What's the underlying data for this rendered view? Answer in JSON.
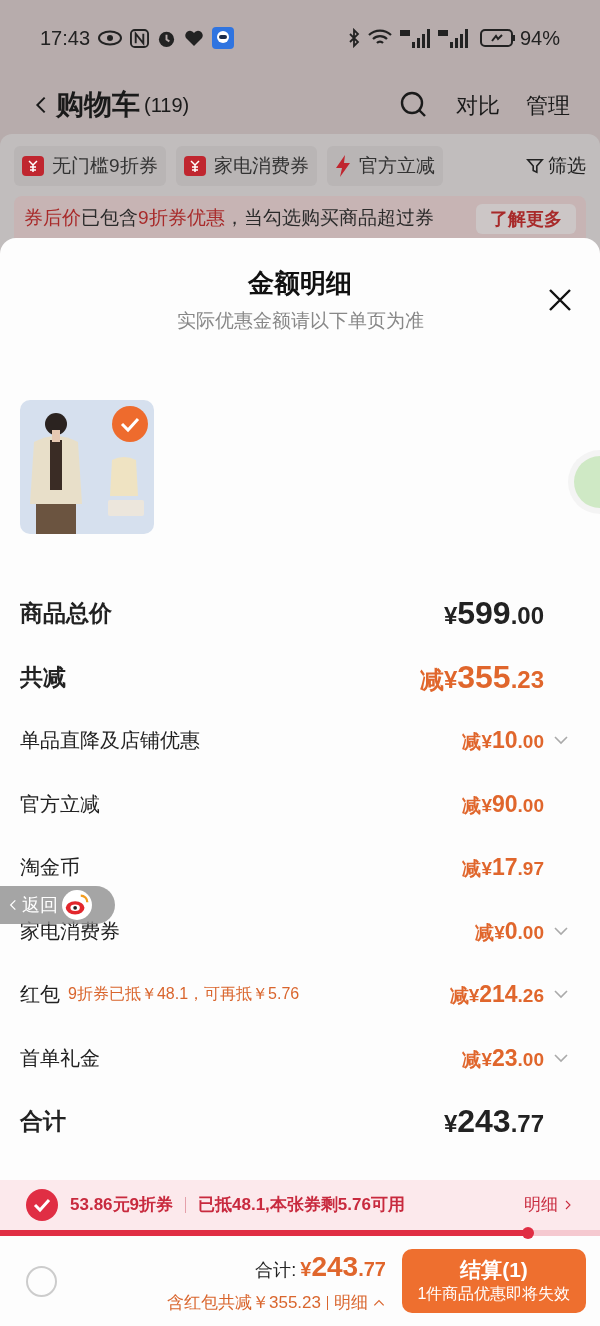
{
  "status_bar": {
    "time": "17:43",
    "battery": "94%"
  },
  "header": {
    "title": "购物车",
    "count": "(119)",
    "actions": [
      "对比",
      "管理"
    ]
  },
  "filters": [
    {
      "label": "无门槛9折券",
      "kind": "coupon"
    },
    {
      "label": "家电消费券",
      "kind": "coupon"
    },
    {
      "label": "官方立减",
      "kind": "bolt"
    },
    {
      "label": "筛选",
      "kind": "filter"
    }
  ],
  "notice": {
    "parts": [
      {
        "text": "券后价",
        "highlight": true
      },
      {
        "text": "已包含",
        "highlight": false
      },
      {
        "text": "9折券优惠",
        "highlight": true
      },
      {
        "text": "，当勾选购买商品超过券",
        "highlight": false
      }
    ],
    "button": "了解更多"
  },
  "sheet": {
    "title": "金额明细",
    "subtitle": "实际优惠金额请以下单页为准",
    "product": {
      "kind": "picture",
      "checked": true
    },
    "rows": [
      {
        "label": "商品总价",
        "kind": "total",
        "prefix": "¥",
        "int": "599",
        "dec": ".00",
        "expandable": false
      },
      {
        "label": "共减",
        "kind": "discount_total",
        "prefix": "减¥",
        "int": "355",
        "dec": ".23",
        "expandable": false
      },
      {
        "label": "单品直降及店铺优惠",
        "kind": "discount",
        "prefix": "减¥",
        "int": "10",
        "dec": ".00",
        "expandable": true
      },
      {
        "label": "官方立减",
        "kind": "discount",
        "prefix": "减¥",
        "int": "90",
        "dec": ".00",
        "expandable": false
      },
      {
        "label": "淘金币",
        "kind": "discount",
        "prefix": "减¥",
        "int": "17",
        "dec": ".97",
        "expandable": false
      },
      {
        "label": "家电消费券",
        "kind": "discount",
        "prefix": "减¥",
        "int": "0",
        "dec": ".00",
        "expandable": true
      },
      {
        "label": "红包",
        "note": "9折券已抵￥48.1，可再抵￥5.76",
        "kind": "discount",
        "prefix": "减¥",
        "int": "214",
        "dec": ".26",
        "expandable": true
      },
      {
        "label": "首单礼金",
        "kind": "discount",
        "prefix": "减¥",
        "int": "23",
        "dec": ".00",
        "expandable": true
      },
      {
        "label": "合计",
        "kind": "total",
        "prefix": "¥",
        "int": "243",
        "dec": ".77",
        "expandable": false
      }
    ]
  },
  "coupon_bar": {
    "checked": true,
    "name": "53.86元9折券",
    "detail": "已抵48.1,本张券剩5.76可用",
    "link": "明细",
    "level": 0.88
  },
  "footer": {
    "select_all_checked": false,
    "total_label": "合计:",
    "total_prefix": "¥",
    "total_int": "243",
    "total_dec": ".77",
    "saving": "含红包共减￥355.23",
    "detail_link": "明细",
    "checkout": "结算(1)",
    "checkout_note": "1件商品优惠即将失效"
  },
  "back_bubble": {
    "label": "返回"
  }
}
